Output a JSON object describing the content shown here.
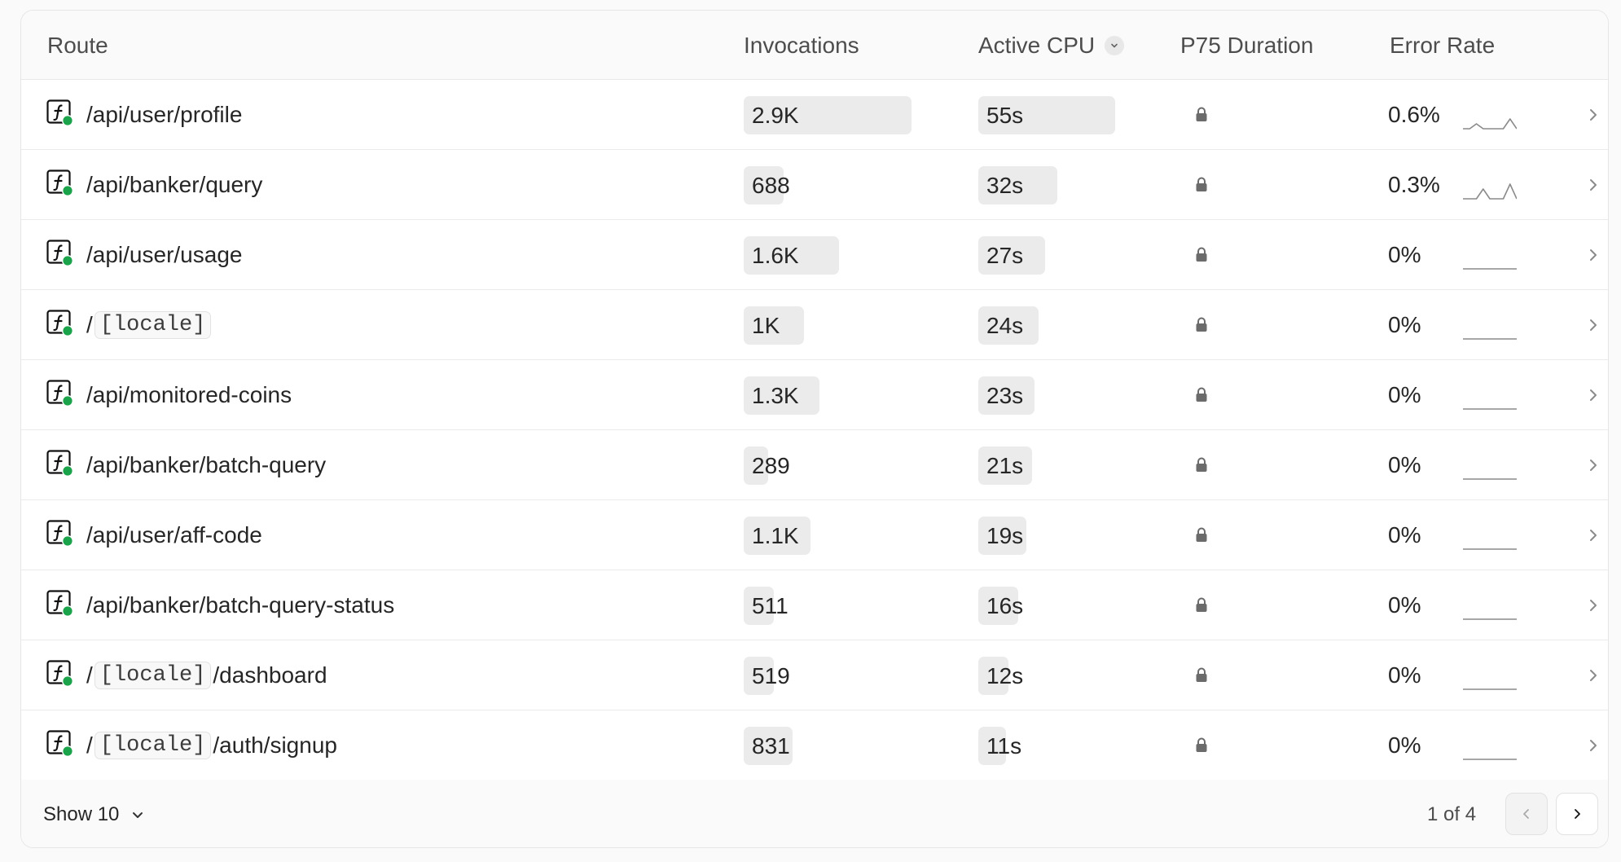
{
  "columns": {
    "route": "Route",
    "invocations": "Invocations",
    "active_cpu": "Active CPU",
    "p75_duration": "P75 Duration",
    "error_rate": "Error Rate"
  },
  "rows": [
    {
      "route": [
        {
          "t": "text",
          "v": "/api/user/profile"
        }
      ],
      "invocations": "2.9K",
      "inv_fraction": 1.0,
      "cpu": "55s",
      "cpu_fraction": 1.0,
      "error_rate": "0.6%",
      "spark": [
        0,
        0,
        1,
        0,
        0,
        0,
        0,
        2,
        0
      ]
    },
    {
      "route": [
        {
          "t": "text",
          "v": "/api/banker/query"
        }
      ],
      "invocations": "688",
      "inv_fraction": 0.24,
      "cpu": "32s",
      "cpu_fraction": 0.58,
      "error_rate": "0.3%",
      "spark": [
        0,
        0,
        0,
        2,
        0,
        0,
        0,
        3,
        0
      ]
    },
    {
      "route": [
        {
          "t": "text",
          "v": "/api/user/usage"
        }
      ],
      "invocations": "1.6K",
      "inv_fraction": 0.57,
      "cpu": "27s",
      "cpu_fraction": 0.49,
      "error_rate": "0%",
      "spark": [
        0,
        0,
        0,
        0,
        0,
        0,
        0,
        0,
        0
      ]
    },
    {
      "route": [
        {
          "t": "text",
          "v": "/"
        },
        {
          "t": "chip",
          "v": "[locale]"
        }
      ],
      "invocations": "1K",
      "inv_fraction": 0.36,
      "cpu": "24s",
      "cpu_fraction": 0.44,
      "error_rate": "0%",
      "spark": [
        0,
        0,
        0,
        0,
        0,
        0,
        0,
        0,
        0
      ]
    },
    {
      "route": [
        {
          "t": "text",
          "v": "/api/monitored-coins"
        }
      ],
      "invocations": "1.3K",
      "inv_fraction": 0.45,
      "cpu": "23s",
      "cpu_fraction": 0.41,
      "error_rate": "0%",
      "spark": [
        0,
        0,
        0,
        0,
        0,
        0,
        0,
        0,
        0
      ]
    },
    {
      "route": [
        {
          "t": "text",
          "v": "/api/banker/batch-query"
        }
      ],
      "invocations": "289",
      "inv_fraction": 0.1,
      "cpu": "21s",
      "cpu_fraction": 0.39,
      "error_rate": "0%",
      "spark": [
        0,
        0,
        0,
        0,
        0,
        0,
        0,
        0,
        0
      ]
    },
    {
      "route": [
        {
          "t": "text",
          "v": "/api/user/aff-code"
        }
      ],
      "invocations": "1.1K",
      "inv_fraction": 0.4,
      "cpu": "19s",
      "cpu_fraction": 0.35,
      "error_rate": "0%",
      "spark": [
        0,
        0,
        0,
        0,
        0,
        0,
        0,
        0,
        0
      ]
    },
    {
      "route": [
        {
          "t": "text",
          "v": "/api/banker/batch-query-status"
        }
      ],
      "invocations": "511",
      "inv_fraction": 0.18,
      "cpu": "16s",
      "cpu_fraction": 0.29,
      "error_rate": "0%",
      "spark": [
        0,
        0,
        0,
        0,
        0,
        0,
        0,
        0,
        0
      ]
    },
    {
      "route": [
        {
          "t": "text",
          "v": "/"
        },
        {
          "t": "chip",
          "v": "[locale]"
        },
        {
          "t": "text",
          "v": "/dashboard"
        }
      ],
      "invocations": "519",
      "inv_fraction": 0.18,
      "cpu": "12s",
      "cpu_fraction": 0.22,
      "error_rate": "0%",
      "spark": [
        0,
        0,
        0,
        0,
        0,
        0,
        0,
        0,
        0
      ]
    },
    {
      "route": [
        {
          "t": "text",
          "v": "/"
        },
        {
          "t": "chip",
          "v": "[locale]"
        },
        {
          "t": "text",
          "v": "/auth/signup"
        }
      ],
      "invocations": "831",
      "inv_fraction": 0.29,
      "cpu": "11s",
      "cpu_fraction": 0.2,
      "error_rate": "0%",
      "spark": [
        0,
        0,
        0,
        0,
        0,
        0,
        0,
        0,
        0
      ]
    }
  ],
  "footer": {
    "show_label": "Show 10",
    "page_label": "1 of 4"
  },
  "icons": {
    "route": "function-icon",
    "status": "green-status-dot",
    "p75": "lock-icon",
    "row_action": "chevron-right-icon",
    "sort": "chevron-down-icon"
  },
  "colors": {
    "status_green": "#1aa34a",
    "bar_fill": "#ebebeb"
  }
}
